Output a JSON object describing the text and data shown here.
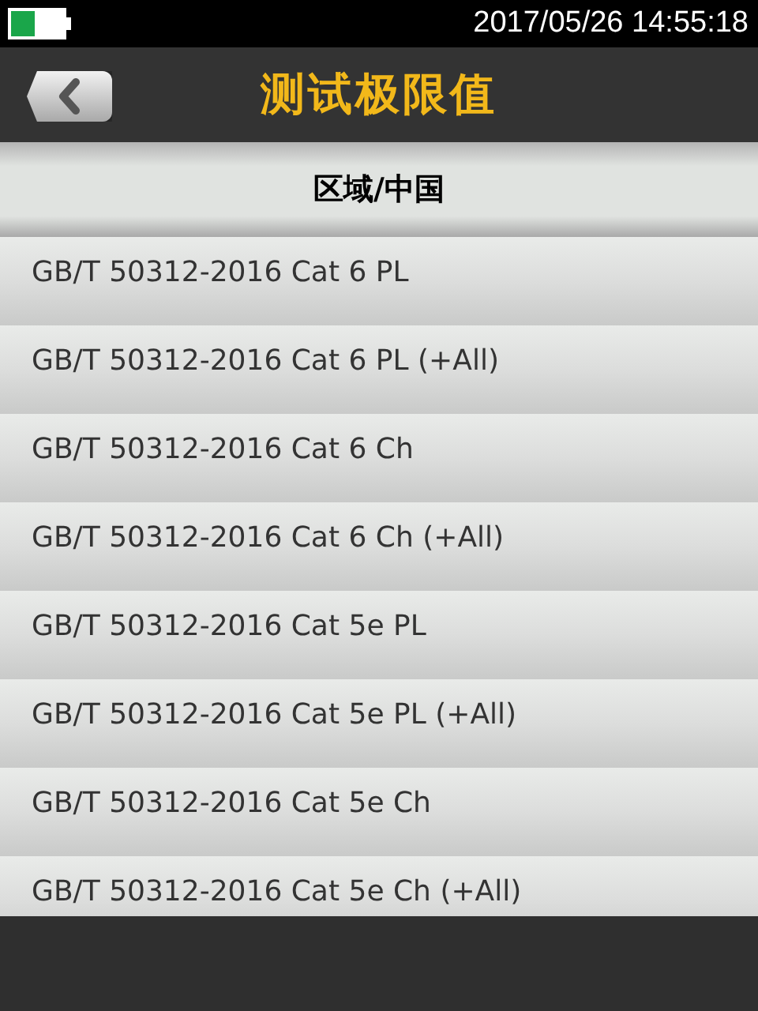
{
  "status_bar": {
    "datetime": "2017/05/26 14:55:18"
  },
  "header": {
    "title": "测试极限值"
  },
  "section": {
    "title": "区域/中国"
  },
  "items": [
    {
      "label": "GB/T 50312-2016 Cat 6 PL"
    },
    {
      "label": "GB/T 50312-2016 Cat 6 PL (+All)"
    },
    {
      "label": "GB/T 50312-2016 Cat 6 Ch"
    },
    {
      "label": "GB/T 50312-2016 Cat 6 Ch (+All)"
    },
    {
      "label": "GB/T 50312-2016 Cat 5e PL"
    },
    {
      "label": "GB/T 50312-2016 Cat 5e PL (+All)"
    },
    {
      "label": "GB/T 50312-2016 Cat 5e Ch"
    },
    {
      "label": "GB/T 50312-2016 Cat 5e Ch (+All)"
    }
  ]
}
